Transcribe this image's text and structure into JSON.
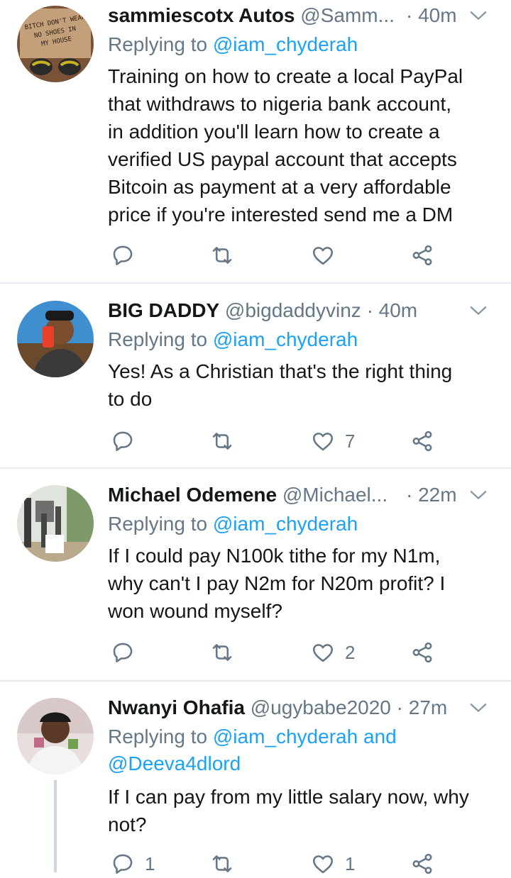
{
  "tweets": [
    {
      "name": "sammiescotx Autos",
      "handle": "@Samm...",
      "time": "· 40m",
      "reply_prefix": "Replying to ",
      "reply_mentions": "@iam_chyderah",
      "text": "Training on how to create a local PayPal\nthat withdraws to nigeria bank account,\nin addition you'll learn how to create a\nverified US paypal account that accepts\nBitcoin as payment at a very affordable\nprice if you're interested send me a DM",
      "reply_count": "",
      "retweet_count": "",
      "like_count": "",
      "avatar_text": "BITCH DON'T WEAR NO SHOES IN MY HOUSE"
    },
    {
      "name": "BIG DADDY",
      "handle": "@bigdaddyvinz",
      "time": "· 40m",
      "reply_prefix": "Replying to ",
      "reply_mentions": "@iam_chyderah",
      "text": "Yes! As a Christian that's the right thing\nto do",
      "reply_count": "",
      "retweet_count": "",
      "like_count": "7"
    },
    {
      "name": "Michael Odemene",
      "handle": "@Michael...",
      "time": "· 22m",
      "reply_prefix": "Replying to ",
      "reply_mentions": "@iam_chyderah",
      "text": "If I could pay N100k tithe for my N1m,\nwhy can't I pay N2m for N20m profit? I\nwon wound myself?",
      "reply_count": "",
      "retweet_count": "",
      "like_count": "2"
    },
    {
      "name": "Nwanyi Ohafia",
      "handle": "@ugybabe2020",
      "time": "· 27m",
      "reply_prefix": "Replying to ",
      "reply_mentions": "@iam_chyderah and",
      "reply_mentions_2": "@Deeva4dlord",
      "text": "If I can pay from my little salary now, why\nnot?",
      "reply_count": "1",
      "retweet_count": "",
      "like_count": "1"
    }
  ],
  "icons": {
    "reply": "reply-icon",
    "retweet": "retweet-icon",
    "like": "heart-icon",
    "share": "share-icon",
    "caret": "chevron-down-icon"
  },
  "colors": {
    "text": "#14171a",
    "secondary": "#657786",
    "link": "#1da1f2",
    "divider": "#e6ecf0"
  }
}
